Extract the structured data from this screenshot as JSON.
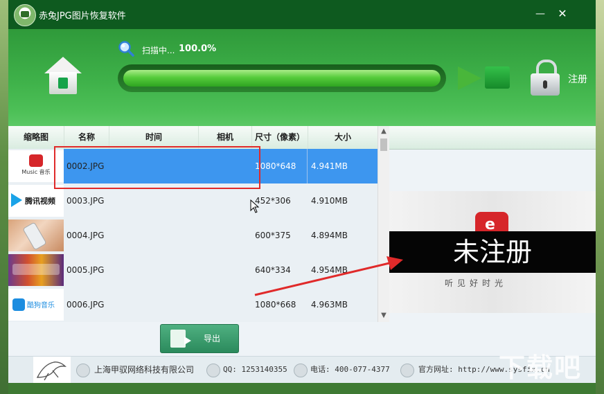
{
  "window": {
    "title": "赤兔JPG图片恢复软件",
    "minimize": "—",
    "close": "✕"
  },
  "toolbar": {
    "scan_status": "扫描中...",
    "progress_text": "100.0%",
    "progress": 1.0,
    "register_label": "注册"
  },
  "table": {
    "columns": [
      "缩略图",
      "名称",
      "时间",
      "相机",
      "尺寸（像素）",
      "大小"
    ],
    "rows": [
      {
        "name": "0002.JPG",
        "time": "",
        "camera": "",
        "dimensions": "1080*648",
        "size": "4.941MB",
        "thumb": "netease-music-thumb",
        "selected": true
      },
      {
        "name": "0003.JPG",
        "time": "",
        "camera": "",
        "dimensions": "452*306",
        "size": "4.910MB",
        "thumb": "tencent-video-thumb",
        "selected": false
      },
      {
        "name": "0004.JPG",
        "time": "",
        "camera": "",
        "dimensions": "600*375",
        "size": "4.894MB",
        "thumb": "iphone-thumb",
        "selected": false
      },
      {
        "name": "0005.JPG",
        "time": "",
        "camera": "",
        "dimensions": "640*334",
        "size": "4.954MB",
        "thumb": "game-thumb",
        "selected": false
      },
      {
        "name": "0006.JPG",
        "time": "",
        "camera": "",
        "dimensions": "1080*668",
        "size": "4.963MB",
        "thumb": "kugou-music-thumb",
        "selected": false
      }
    ]
  },
  "thumb_labels": {
    "netease": "Music 音乐",
    "tencent": "腾讯视频",
    "kugou": "酷狗音乐"
  },
  "preview": {
    "watermark": "未注册",
    "caption": "听见好时光"
  },
  "export": {
    "label": "导出"
  },
  "footer": {
    "company": "上海甲驭网络科技有限公司",
    "qq": "QQ: 1253140355",
    "phone": "电话: 400-077-4377",
    "website": "官方网址: http://www.sysfix.cn"
  },
  "site_watermark": "下载吧",
  "colors": {
    "titlebar": "#0e5a1f",
    "toolbar": "#3fb24a",
    "selection": "#3d96ef",
    "annotation": "#e02a2a"
  }
}
